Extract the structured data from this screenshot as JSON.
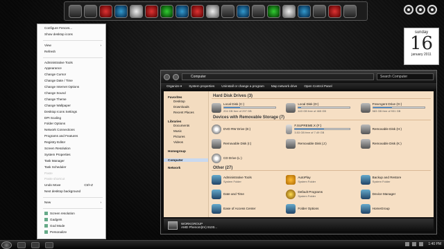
{
  "context_menu": {
    "items": [
      {
        "label": "Configure Fences...",
        "type": "item"
      },
      {
        "label": "Show desktop icons",
        "type": "item"
      },
      {
        "type": "sep"
      },
      {
        "label": "View",
        "type": "item",
        "arrow": true
      },
      {
        "label": "Refresh",
        "type": "item"
      },
      {
        "type": "sep"
      },
      {
        "label": "Administrative Tools",
        "type": "item"
      },
      {
        "label": "Appearance",
        "type": "item"
      },
      {
        "label": "Change Cursor",
        "type": "item"
      },
      {
        "label": "Change Date / Time",
        "type": "item"
      },
      {
        "label": "Change Internet Options",
        "type": "item"
      },
      {
        "label": "Change Sound",
        "type": "item"
      },
      {
        "label": "Change Theme",
        "type": "item"
      },
      {
        "label": "Change Wallpaper",
        "type": "item"
      },
      {
        "label": "Desktop Icons Settings",
        "type": "item"
      },
      {
        "label": "DPI Scaling",
        "type": "item"
      },
      {
        "label": "Folder Options",
        "type": "item"
      },
      {
        "label": "Network Connections",
        "type": "item"
      },
      {
        "label": "Programs and Features",
        "type": "item"
      },
      {
        "label": "Registry Editor",
        "type": "item"
      },
      {
        "label": "Screen Resolution",
        "type": "item"
      },
      {
        "label": "System Properties",
        "type": "item"
      },
      {
        "label": "Task Manager",
        "type": "item"
      },
      {
        "label": "Task Scheduler",
        "type": "item"
      },
      {
        "label": "Paste",
        "type": "item",
        "disabled": true
      },
      {
        "label": "Paste shortcut",
        "type": "item",
        "disabled": true
      },
      {
        "label": "Undo Move",
        "type": "item",
        "shortcut": "Ctrl+Z"
      },
      {
        "label": "Next desktop background",
        "type": "item"
      },
      {
        "type": "sep"
      },
      {
        "label": "New",
        "type": "item",
        "arrow": true
      },
      {
        "type": "sep"
      },
      {
        "label": "Screen resolution",
        "type": "item",
        "icon": true
      },
      {
        "label": "Gadgets",
        "type": "item",
        "icon": true
      },
      {
        "label": "God Mode",
        "type": "item",
        "icon": true
      },
      {
        "label": "Personalize",
        "type": "item",
        "icon": true
      }
    ]
  },
  "calendar": {
    "weekday": "sunday",
    "day": "16",
    "month_year": "january 2011"
  },
  "explorer": {
    "address": "Computer",
    "search_placeholder": "Search Computer",
    "commands": [
      "Organize ▾",
      "System properties",
      "Uninstall or change a program",
      "Map network drive",
      "Open Control Panel"
    ],
    "nav": {
      "favorites": {
        "heading": "Favorites",
        "items": [
          "Desktop",
          "Downloads",
          "Recent Places"
        ]
      },
      "libraries": {
        "heading": "Libraries",
        "items": [
          "Documents",
          "Music",
          "Pictures",
          "Videos"
        ]
      },
      "homegroup": "Homegroup",
      "computer": "Computer",
      "network": "Network"
    },
    "groups": {
      "hdd": {
        "title": "Hard Disk Drives (3)",
        "items": [
          {
            "name": "Local Disk (C:)",
            "free": "204 GB free of 297 GB",
            "used_fraction": 0.31
          },
          {
            "name": "Local Disk (D:)",
            "free": "443 GB free of 465 GB",
            "used_fraction": 0.05
          },
          {
            "name": "FreeAgent Drive (G:)",
            "free": "583 GB free of 931 GB",
            "used_fraction": 0.37
          }
        ]
      },
      "removable": {
        "title": "Devices with Removable Storage (7)",
        "items": [
          {
            "name": "DVD RW Drive (E:)",
            "icon": "dvd"
          },
          {
            "name": "F.SUPREME.X (F:)",
            "sub": "3.53 GB free of 7.49 GB",
            "used_fraction": 0.53,
            "icon": "usb"
          },
          {
            "name": "Removable Disk (H:)",
            "icon": "disk"
          },
          {
            "name": "Removable Disk (I:)",
            "icon": "disk"
          },
          {
            "name": "Removable Disk (J:)",
            "icon": "disk"
          },
          {
            "name": "Removable Disk (K:)",
            "icon": "disk"
          },
          {
            "name": "CD Drive (L:)",
            "icon": "dvd"
          }
        ]
      },
      "other": {
        "title": "Other (27)",
        "items": [
          {
            "name": "Administrative Tools",
            "sub": "System Folder",
            "icon": "cp"
          },
          {
            "name": "AutoPlay",
            "sub": "System Folder",
            "icon": "ap"
          },
          {
            "name": "Backup and Restore",
            "sub": "System Folder",
            "icon": "cp"
          },
          {
            "name": "Date and Time",
            "icon": "cp"
          },
          {
            "name": "Default Programs",
            "sub": "System Folder",
            "icon": "dp"
          },
          {
            "name": "Device Manager",
            "icon": "cp"
          },
          {
            "name": "Ease of Access Center",
            "icon": "cp"
          },
          {
            "name": "Folder Options",
            "icon": "cp"
          },
          {
            "name": "HomeGroup",
            "icon": "cp"
          }
        ]
      }
    },
    "status": {
      "line1": "WORKGROUP",
      "line2": "AMD Phenom(tm) 9100..."
    }
  },
  "taskbar": {
    "clock": "1:40 PM"
  }
}
